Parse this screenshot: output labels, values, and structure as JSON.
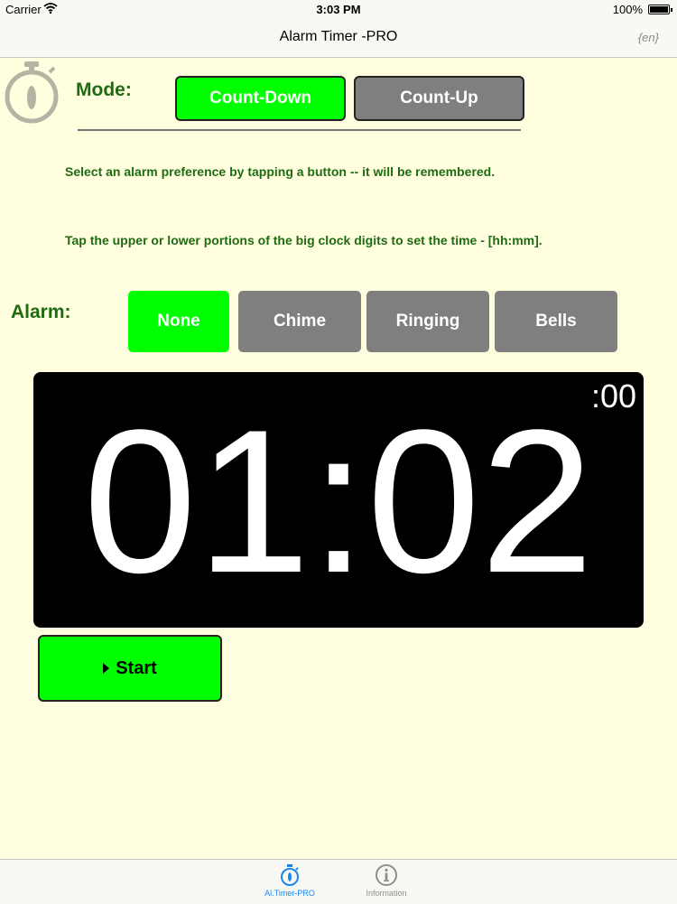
{
  "status_bar": {
    "carrier": "Carrier",
    "time": "3:03 PM",
    "battery": "100%"
  },
  "nav": {
    "title": "Alarm Timer -PRO",
    "language": "{en}"
  },
  "mode": {
    "label": "Mode:",
    "options": [
      "Count-Down",
      "Count-Up"
    ],
    "selected": "Count-Down"
  },
  "instructions": [
    "Select an alarm preference by tapping a button -- it will be remembered.",
    "Tap the upper or lower portions of the big clock digits to set the time - [hh:mm]."
  ],
  "alarm": {
    "label": "Alarm:",
    "options": [
      "None",
      "Chime",
      "Ringing",
      "Bells"
    ],
    "selected": "None"
  },
  "clock": {
    "display": "01:02",
    "seconds": ":00"
  },
  "start_button": {
    "label": "Start"
  },
  "tabs": [
    {
      "label": "Al.Timer-PRO",
      "icon": "stopwatch-icon",
      "active": true
    },
    {
      "label": "Information",
      "icon": "info-icon",
      "active": false
    }
  ],
  "colors": {
    "background": "#ffffe0",
    "accent_green": "#00ff00",
    "label_green": "#1f6b12",
    "button_gray": "#7f7f7f",
    "tab_blue": "#1a86f0"
  }
}
